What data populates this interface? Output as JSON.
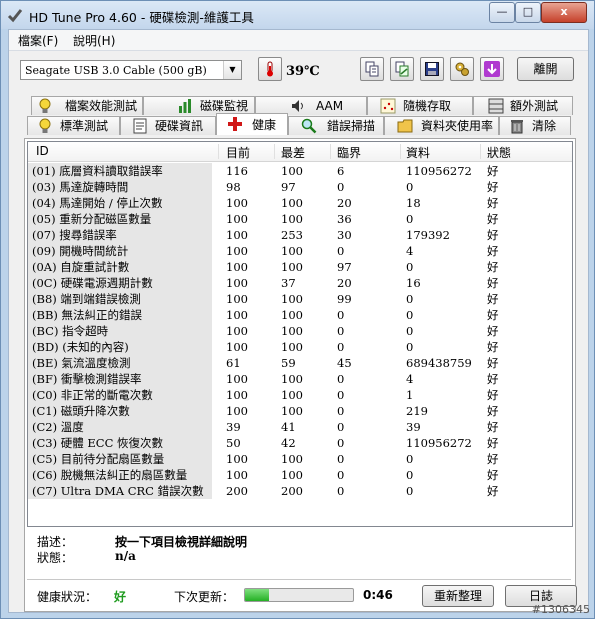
{
  "window": {
    "title": "HD Tune Pro 4.60 - 硬碟檢測-維護工具",
    "minimize": "—",
    "maximize": "□",
    "close": "x"
  },
  "menu": [
    {
      "label": "檔案(F)"
    },
    {
      "label": "說明(H)"
    }
  ],
  "toolbar": {
    "drive": "Seagate USB 3.0 Cable    (500 gB)",
    "temperature": "39℃",
    "exit_label": "離開"
  },
  "tabs_top": [
    {
      "label": "檔案效能測試"
    },
    {
      "label": "磁碟監視"
    },
    {
      "label": "AAM"
    },
    {
      "label": "隨機存取"
    },
    {
      "label": "額外測試"
    }
  ],
  "tabs_bottom": [
    {
      "label": "標準測試"
    },
    {
      "label": "硬碟資訊"
    },
    {
      "label": "健康"
    },
    {
      "label": "錯誤掃描"
    },
    {
      "label": "資料夾使用率"
    },
    {
      "label": "清除"
    }
  ],
  "columns": [
    "ID",
    "目前",
    "最差",
    "臨界",
    "資料",
    "狀態"
  ],
  "rows": [
    [
      "(01) 底層資料讀取錯誤率",
      "116",
      "100",
      "6",
      "110956272",
      "好"
    ],
    [
      "(03) 馬達旋轉時間",
      "98",
      "97",
      "0",
      "0",
      "好"
    ],
    [
      "(04) 馬達開始 / 停止次數",
      "100",
      "100",
      "20",
      "18",
      "好"
    ],
    [
      "(05) 重新分配磁區數量",
      "100",
      "100",
      "36",
      "0",
      "好"
    ],
    [
      "(07) 搜尋錯誤率",
      "100",
      "253",
      "30",
      "179392",
      "好"
    ],
    [
      "(09) 開機時間統計",
      "100",
      "100",
      "0",
      "4",
      "好"
    ],
    [
      "(0A) 自旋重試計數",
      "100",
      "100",
      "97",
      "0",
      "好"
    ],
    [
      "(0C) 硬碟電源週期計數",
      "100",
      "37",
      "20",
      "16",
      "好"
    ],
    [
      "(B8) 端到端錯誤檢測",
      "100",
      "100",
      "99",
      "0",
      "好"
    ],
    [
      "(BB) 無法糾正的錯誤",
      "100",
      "100",
      "0",
      "0",
      "好"
    ],
    [
      "(BC) 指令超時",
      "100",
      "100",
      "0",
      "0",
      "好"
    ],
    [
      "(BD) (未知的內容)",
      "100",
      "100",
      "0",
      "0",
      "好"
    ],
    [
      "(BE) 氣流溫度檢測",
      "61",
      "59",
      "45",
      "689438759",
      "好"
    ],
    [
      "(BF) 衝擊檢測錯誤率",
      "100",
      "100",
      "0",
      "4",
      "好"
    ],
    [
      "(C0) 非正常的斷電次數",
      "100",
      "100",
      "0",
      "1",
      "好"
    ],
    [
      "(C1) 磁頭升降次數",
      "100",
      "100",
      "0",
      "219",
      "好"
    ],
    [
      "(C2) 溫度",
      "39",
      "41",
      "0",
      "39",
      "好"
    ],
    [
      "(C3) 硬體 ECC 恢復次數",
      "50",
      "42",
      "0",
      "110956272",
      "好"
    ],
    [
      "(C5) 目前待分配扇區數量",
      "100",
      "100",
      "0",
      "0",
      "好"
    ],
    [
      "(C6) 脫機無法糾正的扇區數量",
      "100",
      "100",
      "0",
      "0",
      "好"
    ],
    [
      "(C7) Ultra DMA CRC 錯誤次數",
      "200",
      "200",
      "0",
      "0",
      "好"
    ]
  ],
  "details": {
    "desc_label": "描述：",
    "desc_value": "按一下項目檢視詳細說明",
    "status_label": "狀態：",
    "status_value": "n/a"
  },
  "footer": {
    "health_label": "健康狀況：",
    "health_value": "好",
    "next_update_label": "下次更新：",
    "progress_fraction": 0.22,
    "time_value": "0:46",
    "refresh_label": "重新整理",
    "log_label": "日誌"
  },
  "watermark": "#1306345",
  "colors": {
    "health_good": "#1f9b1f",
    "progress": "#24b024"
  }
}
